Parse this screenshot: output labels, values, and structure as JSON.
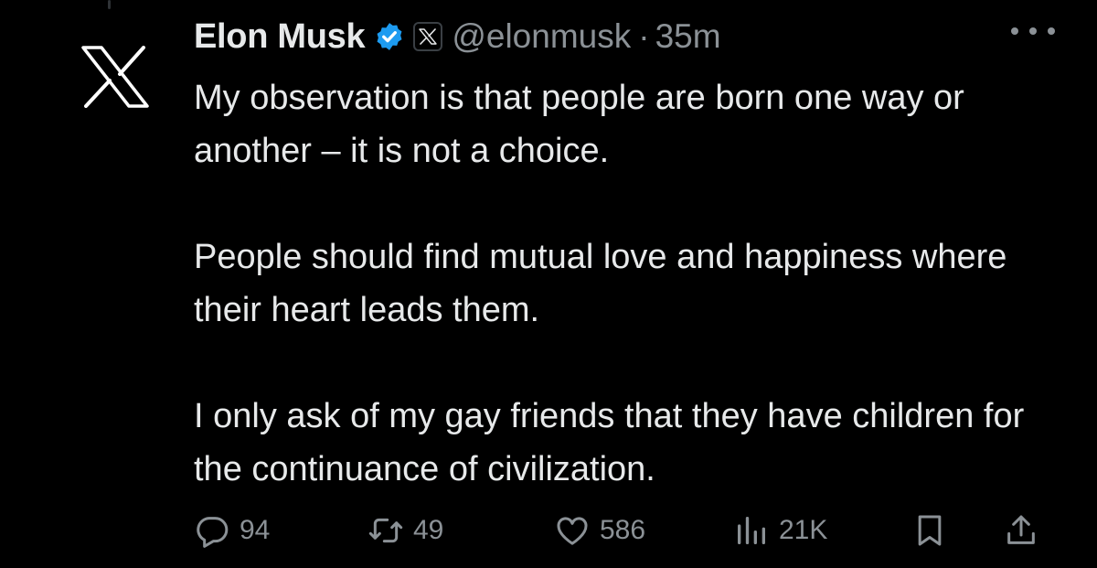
{
  "tweet": {
    "author_name": "Elon Musk",
    "handle": "@elonmusk",
    "separator": "·",
    "time": "35m",
    "paragraphs": [
      "My observation is that people are born one way or another – it is not a choice.",
      "People should find mutual love and happiness where their heart leads them.",
      "I only ask of my gay friends that they have children for the continuance of civilization."
    ]
  },
  "stats": {
    "replies": "94",
    "reposts": "49",
    "likes": "586",
    "views": "21K"
  },
  "icons": {
    "avatar": "x-logo-icon",
    "verified": "verified-badge-icon",
    "affiliation": "x-affiliation-icon",
    "more": "more-options-icon",
    "reply": "reply-icon",
    "repost": "repost-icon",
    "like": "like-icon",
    "views": "views-icon",
    "bookmark": "bookmark-icon",
    "share": "share-icon"
  },
  "colors": {
    "background": "#000000",
    "text": "#e7e9ea",
    "secondary": "#8b9196",
    "verified": "#1d9bf0"
  }
}
